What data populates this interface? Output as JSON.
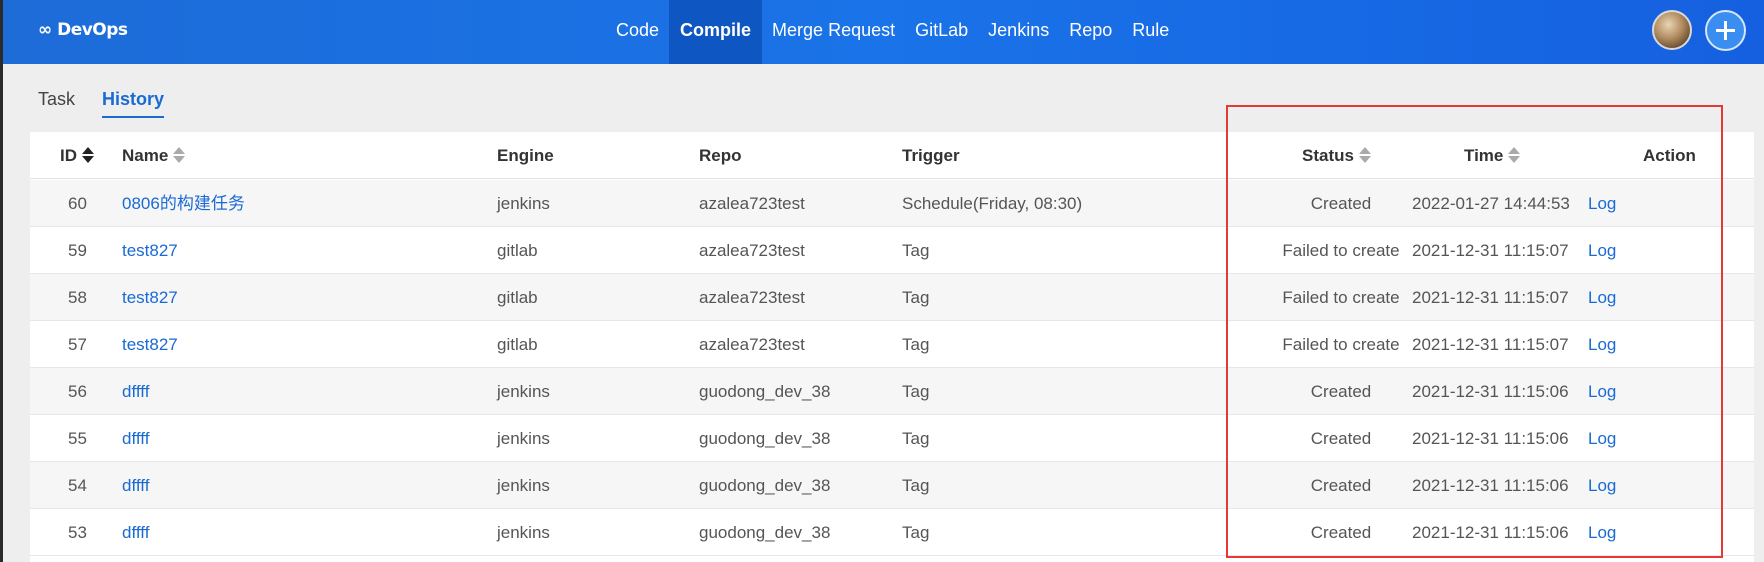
{
  "app": {
    "logo": "∞ DevOps"
  },
  "nav": [
    "Code",
    "Compile",
    "Merge Request",
    "GitLab",
    "Jenkins",
    "Repo",
    "Rule"
  ],
  "nav_active": "Compile",
  "tabs": [
    "Task",
    "History"
  ],
  "tab_active": "History",
  "table": {
    "headers": {
      "id": "ID",
      "name": "Name",
      "engine": "Engine",
      "repo": "Repo",
      "trigger": "Trigger",
      "status": "Status",
      "time": "Time",
      "action": "Action"
    },
    "rows": [
      {
        "id": "60",
        "name": "0806的构建任务",
        "engine": "jenkins",
        "repo": "azalea723test",
        "trigger": "Schedule(Friday, 08:30)",
        "status": "Created",
        "time": "2022-01-27 14:44:53",
        "action": "Log"
      },
      {
        "id": "59",
        "name": "test827",
        "engine": "gitlab",
        "repo": "azalea723test",
        "trigger": "Tag",
        "status": "Failed to create",
        "time": "2021-12-31 11:15:07",
        "action": "Log"
      },
      {
        "id": "58",
        "name": "test827",
        "engine": "gitlab",
        "repo": "azalea723test",
        "trigger": "Tag",
        "status": "Failed to create",
        "time": "2021-12-31 11:15:07",
        "action": "Log"
      },
      {
        "id": "57",
        "name": "test827",
        "engine": "gitlab",
        "repo": "azalea723test",
        "trigger": "Tag",
        "status": "Failed to create",
        "time": "2021-12-31 11:15:07",
        "action": "Log"
      },
      {
        "id": "56",
        "name": "dffff",
        "engine": "jenkins",
        "repo": "guodong_dev_38",
        "trigger": "Tag",
        "status": "Created",
        "time": "2021-12-31 11:15:06",
        "action": "Log"
      },
      {
        "id": "55",
        "name": "dffff",
        "engine": "jenkins",
        "repo": "guodong_dev_38",
        "trigger": "Tag",
        "status": "Created",
        "time": "2021-12-31 11:15:06",
        "action": "Log"
      },
      {
        "id": "54",
        "name": "dffff",
        "engine": "jenkins",
        "repo": "guodong_dev_38",
        "trigger": "Tag",
        "status": "Created",
        "time": "2021-12-31 11:15:06",
        "action": "Log"
      },
      {
        "id": "53",
        "name": "dffff",
        "engine": "jenkins",
        "repo": "guodong_dev_38",
        "trigger": "Tag",
        "status": "Created",
        "time": "2021-12-31 11:15:06",
        "action": "Log"
      }
    ]
  },
  "icons": {
    "logo": "infinity-icon",
    "add": "plus-icon",
    "avatar": "user-avatar"
  },
  "colors": {
    "topbar": "#1a73e8",
    "accent": "#1a6ad3",
    "highlight": "#e53935"
  }
}
